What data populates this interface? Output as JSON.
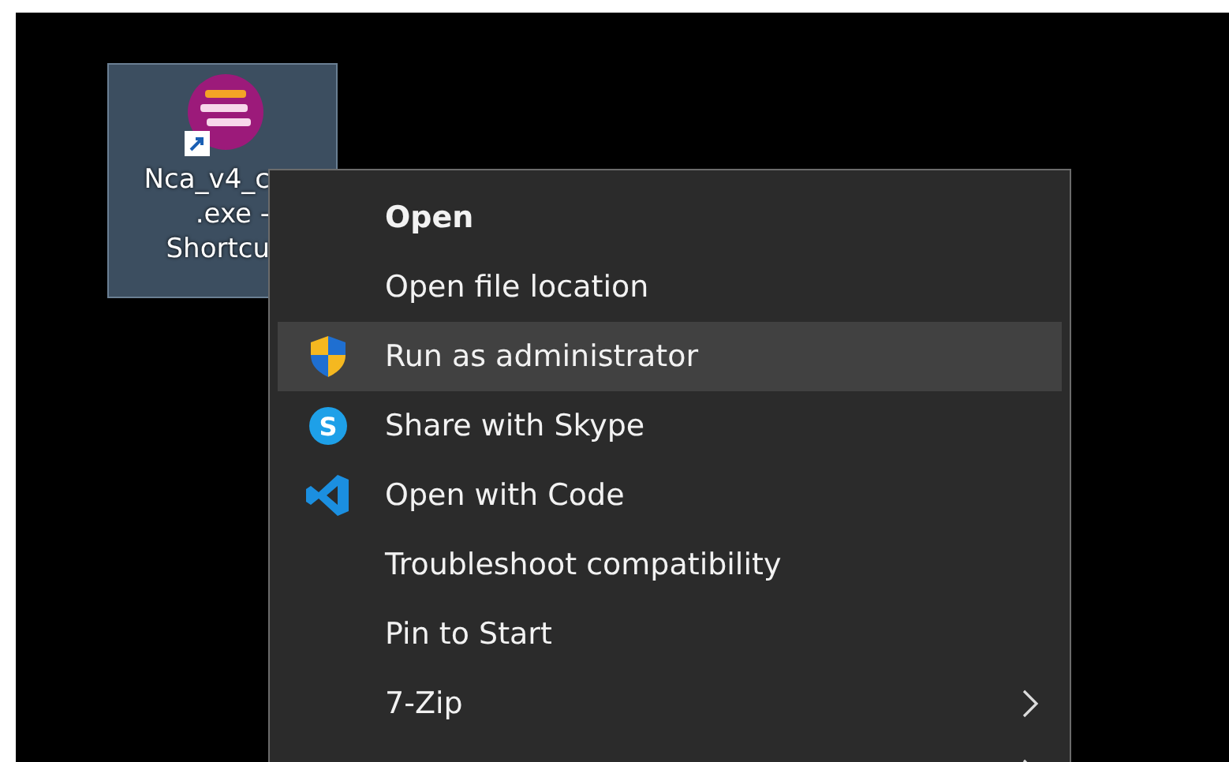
{
  "desktop_icon": {
    "label_lines": [
      "Nca_v4_c",
      ".exe -",
      "Shortcu"
    ],
    "selected": true,
    "shortcut": true
  },
  "context_menu": {
    "items": [
      {
        "label": "Open",
        "default": true,
        "selected": false,
        "kind": "plain",
        "submenu": false
      },
      {
        "label": "Open file location",
        "default": false,
        "selected": false,
        "kind": "plain",
        "submenu": false
      },
      {
        "label": "Run as administrator",
        "default": false,
        "selected": true,
        "kind": "shield",
        "submenu": false
      },
      {
        "label": "Share with Skype",
        "default": false,
        "selected": false,
        "kind": "badge",
        "glyph": "S",
        "submenu": false
      },
      {
        "label": "Open with Code",
        "default": false,
        "selected": false,
        "kind": "editor",
        "submenu": false
      },
      {
        "label": "Troubleshoot compatibility",
        "default": false,
        "selected": false,
        "kind": "plain",
        "submenu": false
      },
      {
        "label": "Pin to Start",
        "default": false,
        "selected": false,
        "kind": "plain",
        "submenu": false
      },
      {
        "label": "7-Zip",
        "default": false,
        "selected": false,
        "kind": "plain",
        "submenu": true
      },
      {
        "default": false,
        "selected": false,
        "kind": "plain",
        "submenu": true
      }
    ]
  }
}
